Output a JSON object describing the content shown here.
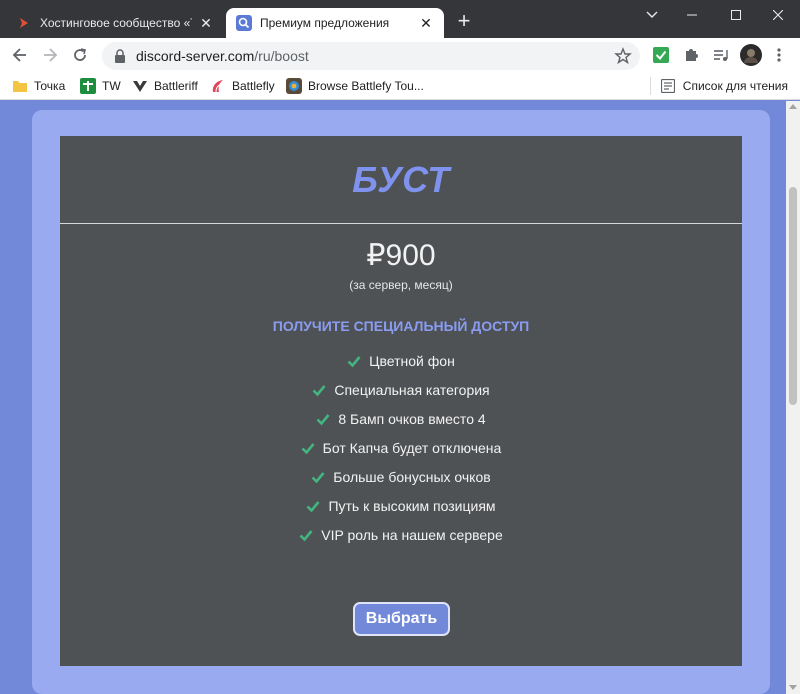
{
  "tabs": [
    {
      "title": "Хостинговое сообщество «Time",
      "favicon": "red-chevron-icon",
      "active": false
    },
    {
      "title": "Премиум предложения",
      "favicon": "search-page-icon",
      "active": true
    }
  ],
  "toolbar": {
    "url_domain": "discord-server.com",
    "url_path": "/ru/boost"
  },
  "bookmarks": [
    {
      "label": "Точка",
      "icon": "folder-icon"
    },
    {
      "label": "TW",
      "icon": "tw-icon"
    },
    {
      "label": "Battleriff",
      "icon": "battleriff-icon"
    },
    {
      "label": "Battlefly",
      "icon": "battlefly-icon"
    },
    {
      "label": "Browse Battlefy Tou...",
      "icon": "battlefy-icon"
    }
  ],
  "reading_list": "Список для чтения",
  "card": {
    "title": "БУСТ",
    "price": "₽900",
    "price_note": "(за сервер, месяц)",
    "access_heading": "ПОЛУЧИТЕ СПЕЦИАЛЬНЫЙ ДОСТУП",
    "features": [
      "Цветной фон",
      "Специальная категория",
      "8 Бамп очков вместо 4",
      "Бот Капча будет отключена",
      "Больше бонусных очков",
      "Путь к высоким позициям",
      "VIP роль на нашем сервере"
    ],
    "button": "Выбрать"
  },
  "colors": {
    "page_bg": "#7289da",
    "card_outer": "#99aaf0",
    "card_inner": "#4f5255",
    "title": "#7f93ee",
    "check": "#43b581"
  }
}
